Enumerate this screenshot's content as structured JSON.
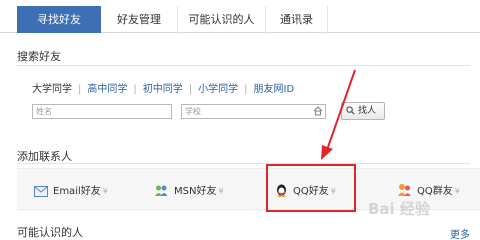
{
  "tabs": [
    {
      "label": "寻找好友",
      "active": true
    },
    {
      "label": "好友管理",
      "active": false
    },
    {
      "label": "可能认识的人",
      "active": false
    },
    {
      "label": "通讯录",
      "active": false
    }
  ],
  "search": {
    "title": "搜索好友",
    "filters": [
      "大学同学",
      "高中同学",
      "初中同学",
      "小学同学",
      "朋友网ID"
    ],
    "name_placeholder": "姓名",
    "school_placeholder": "学校",
    "find_button": "找人"
  },
  "add_contacts": {
    "title": "添加联系人",
    "items": [
      {
        "label": "Email好友",
        "icon": "envelope-icon"
      },
      {
        "label": "MSN好友",
        "icon": "msn-icon"
      },
      {
        "label": "QQ好友",
        "icon": "qq-penguin-icon"
      },
      {
        "label": "QQ群友",
        "icon": "qq-group-icon"
      }
    ],
    "highlight_color": "#e0262b"
  },
  "maybe_known": {
    "title": "可能认识的人",
    "more_link": "更多"
  },
  "watermark": "Bai 经验",
  "colors": {
    "active_tab": "#3d6fb4",
    "link": "#2a5fa8",
    "annotation": "#e0262b"
  }
}
